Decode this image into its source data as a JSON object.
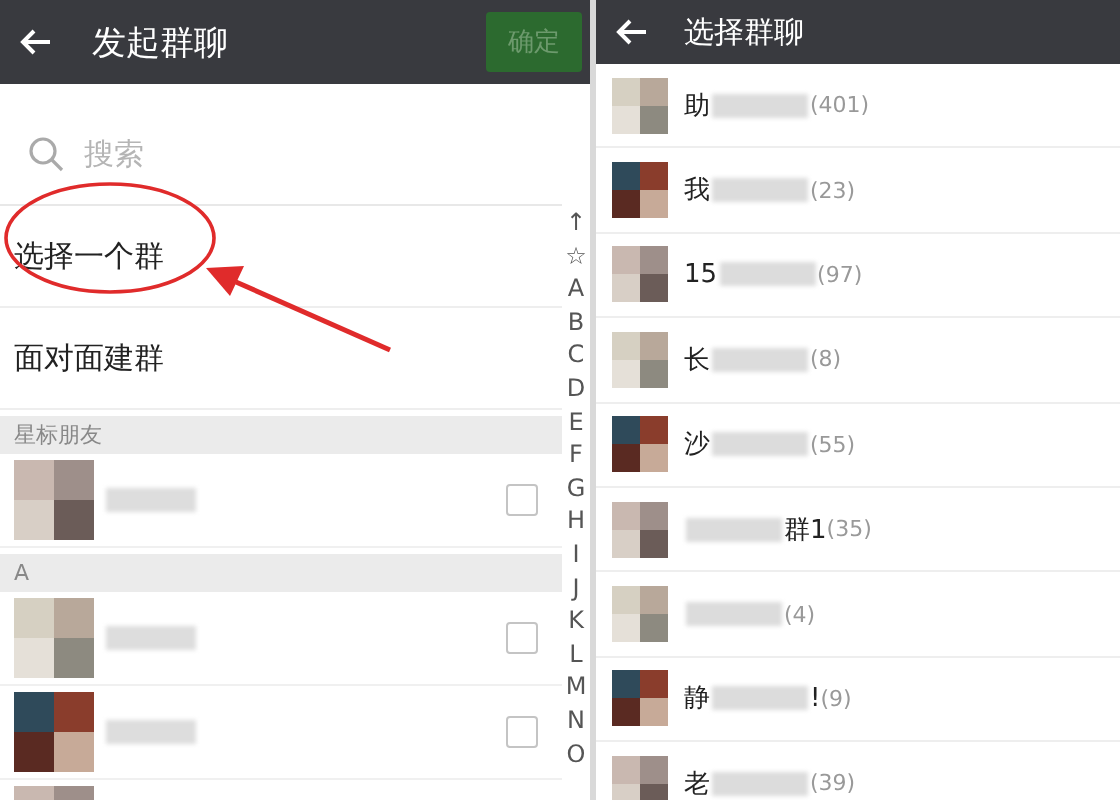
{
  "left": {
    "header": {
      "title": "发起群聊",
      "confirm_button": {
        "label": "确定",
        "disabled": true
      }
    },
    "search": {
      "placeholder": "搜索"
    },
    "options": [
      {
        "label": "选择一个群",
        "annotated": true
      },
      {
        "label": "面对面建群",
        "annotated": false
      }
    ],
    "sections": [
      {
        "title": "星标朋友",
        "contacts": [
          {
            "checked": false
          }
        ]
      },
      {
        "title": "A",
        "contacts": [
          {
            "checked": false
          },
          {
            "checked": false
          },
          {
            "cut_off": true
          }
        ]
      }
    ],
    "index": [
      "↑",
      "☆",
      "A",
      "B",
      "C",
      "D",
      "E",
      "F",
      "G",
      "H",
      "I",
      "J",
      "K",
      "L",
      "M",
      "N",
      "O"
    ]
  },
  "right": {
    "header": {
      "title": "选择群聊"
    },
    "groups": [
      {
        "name_start": "助",
        "count": "(401)"
      },
      {
        "name_start": "我",
        "count": "(23)"
      },
      {
        "name_start": "15",
        "count": "(97)"
      },
      {
        "name_start": "长",
        "count": "(8)"
      },
      {
        "name_start": "沙",
        "count": "(55)"
      },
      {
        "name_end": "群1",
        "count": "(35)"
      },
      {
        "count": "(4)"
      },
      {
        "name_start": "静",
        "name_end": "!",
        "count": "(9)"
      },
      {
        "name_start": "老",
        "count": "(39)"
      }
    ]
  }
}
